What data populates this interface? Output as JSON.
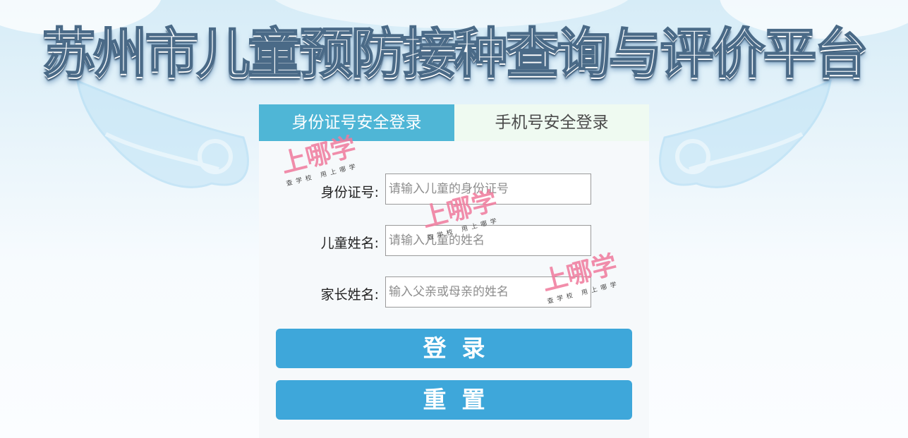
{
  "header": {
    "title": "苏州市儿童预防接种查询与评价平台"
  },
  "tabs": [
    {
      "label": "身份证号安全登录",
      "active": true
    },
    {
      "label": "手机号安全登录",
      "active": false
    }
  ],
  "form": {
    "id_label": "身份证号:",
    "id_placeholder": "请输入儿童的身份证号",
    "id_value": "",
    "child_name_label": "儿童姓名:",
    "child_name_placeholder": "请输入儿童的姓名",
    "child_name_value": "",
    "parent_name_label": "家长姓名:",
    "parent_name_placeholder": "输入父亲或母亲的姓名",
    "parent_name_value": ""
  },
  "buttons": {
    "login": "登录",
    "reset": "重置"
  },
  "watermark": {
    "main": "上哪学",
    "sub": "查学校  用上哪学"
  },
  "colors": {
    "tab_active": "#4fb6d6",
    "tab_inactive": "#effaf1",
    "button": "#3ea7da",
    "watermark": "#f07a9c"
  }
}
